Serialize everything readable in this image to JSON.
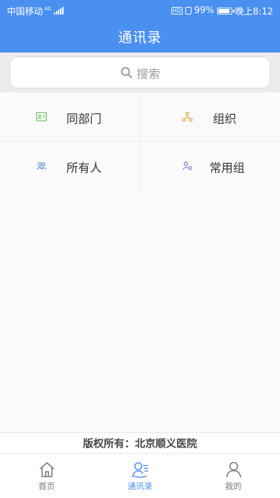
{
  "status_bar": {
    "carrier": "中国移动",
    "network": "4G",
    "battery": "99%",
    "time": "晚上8:12"
  },
  "header": {
    "title": "通讯录"
  },
  "search": {
    "placeholder": "搜索"
  },
  "menu": [
    {
      "label": "同部门",
      "icon": "contact-card-icon",
      "color": "#6cbf5a"
    },
    {
      "label": "组织",
      "icon": "org-tree-icon",
      "color": "#e4a73a"
    },
    {
      "label": "所有人",
      "icon": "people-icon",
      "color": "#5b8fd8"
    },
    {
      "label": "常用组",
      "icon": "group-settings-icon",
      "color": "#8a7fd0"
    }
  ],
  "footer": {
    "copyright": "版权所有：北京顺义医院"
  },
  "tabs": [
    {
      "label": "首页",
      "icon": "home-icon",
      "active": false
    },
    {
      "label": "通讯录",
      "icon": "contacts-icon",
      "active": true
    },
    {
      "label": "我的",
      "icon": "profile-icon",
      "active": false
    }
  ],
  "colors": {
    "primary": "#4a90f0"
  }
}
